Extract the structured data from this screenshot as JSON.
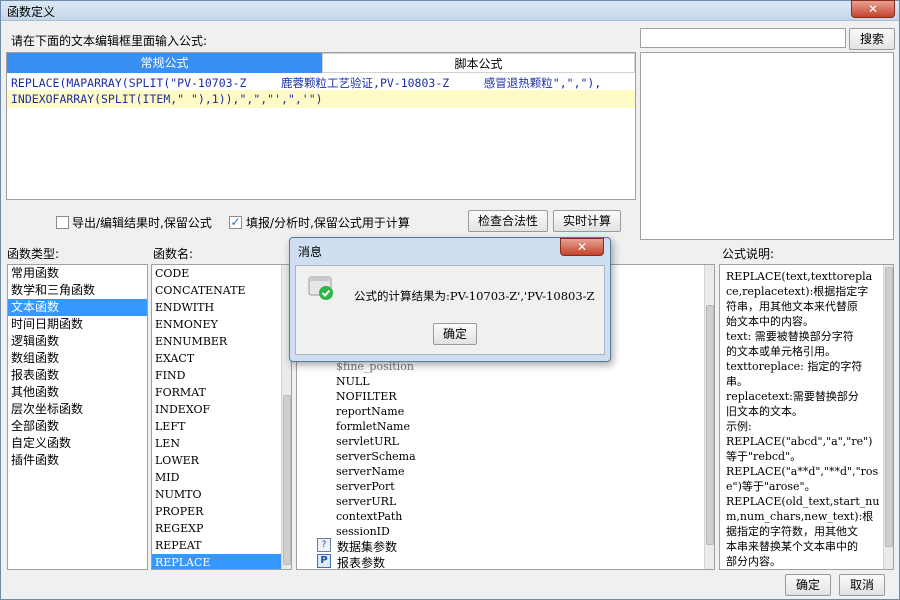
{
  "window": {
    "title": "函数定义",
    "close_glyph": "✕"
  },
  "editor": {
    "prompt": "请在下面的文本编辑框里面输入公式:",
    "tabs": [
      "常规公式",
      "脚本公式"
    ],
    "active_tab": 0,
    "formula_line1": "REPLACE(MAPARRAY(SPLIT(\"PV-10703-Z     鹿蓉颗粒工艺验证,PV-10803-Z     感冒退热颗粒\",\",\"),",
    "formula_line2": "INDEXOFARRAY(SPLIT(ITEM,\" \"),1)),\",\",\"',\",'\")"
  },
  "search": {
    "value": "",
    "button": "搜索"
  },
  "options": {
    "keep_on_export_label": "导出/编辑结果时,保留公式",
    "keep_on_export_checked": false,
    "keep_on_fill_label": "填报/分析时,保留公式用于计算",
    "keep_on_fill_checked": true,
    "check_button": "检查合法性",
    "calc_button": "实时计算"
  },
  "categories": {
    "header": "函数类型:",
    "items": [
      "常用函数",
      "数学和三角函数",
      "文本函数",
      "时间日期函数",
      "逻辑函数",
      "数组函数",
      "报表函数",
      "其他函数",
      "层次坐标函数",
      "全部函数",
      "自定义函数",
      "插件函数"
    ],
    "selected": 2
  },
  "functions": {
    "header": "函数名:",
    "items": [
      "CODE",
      "CONCATENATE",
      "ENDWITH",
      "ENMONEY",
      "ENNUMBER",
      "EXACT",
      "FIND",
      "FORMAT",
      "INDEXOF",
      "LEFT",
      "LEN",
      "LOWER",
      "MID",
      "NUMTO",
      "PROPER",
      "REGEXP",
      "REPEAT",
      "REPLACE"
    ],
    "selected": 17
  },
  "params": {
    "partial_top": "$fine_position",
    "items": [
      "NULL",
      "NOFILTER",
      "reportName",
      "formletName",
      "servletURL",
      "serverSchema",
      "serverName",
      "serverPort",
      "serverURL",
      "contextPath",
      "sessionID"
    ],
    "groups": [
      "数据集参数",
      "报表参数"
    ]
  },
  "description": {
    "header": "公式说明:",
    "lines": [
      "REPLACE(text,texttorepla",
      "ce,replacetext):根据指定字",
      "符串，用其他文本来代替原",
      "始文本中的内容。",
      "text: 需要被替换部分字符",
      "的文本或单元格引用。",
      "texttoreplace: 指定的字符",
      "串。",
      "replacetext:需要替换部分",
      "旧文本的文本。",
      "示例:",
      "REPLACE(\"abcd\",\"a\",\"re\")",
      "等于\"rebcd\"。",
      "REPLACE(\"a**d\",\"**d\",\"ros",
      "e\")等于\"arose\"。",
      "REPLACE(old_text,start_nu",
      "m,num_chars,new_text):根",
      "据指定的字符数，用其他文",
      "本串来替换某个文本串中的",
      "部分内容。"
    ]
  },
  "footer": {
    "ok": "确定",
    "cancel": "取消"
  },
  "message_dialog": {
    "title": "消息",
    "close_glyph": "✕",
    "text": "公式的计算结果为:PV-10703-Z','PV-10803-Z",
    "ok": "确定"
  }
}
